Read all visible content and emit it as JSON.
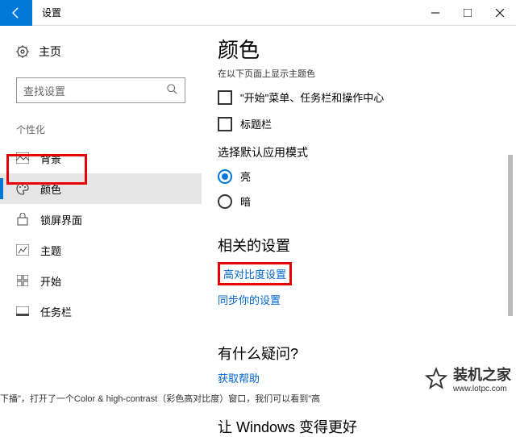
{
  "titlebar": {
    "title": "设置"
  },
  "sidebar": {
    "home": "主页",
    "search_placeholder": "查找设置",
    "section": "个性化",
    "items": [
      {
        "label": "背景",
        "icon": "image-icon"
      },
      {
        "label": "颜色",
        "icon": "palette-icon"
      },
      {
        "label": "锁屏界面",
        "icon": "lock-icon"
      },
      {
        "label": "主题",
        "icon": "theme-icon"
      },
      {
        "label": "开始",
        "icon": "start-icon"
      },
      {
        "label": "任务栏",
        "icon": "taskbar-icon"
      }
    ]
  },
  "main": {
    "title": "颜色",
    "truncated": "在以下页面上显示主题色",
    "checkbox1": "\"开始\"菜单、任务栏和操作中心",
    "checkbox2": "标题栏",
    "mode_heading": "选择默认应用模式",
    "mode_light": "亮",
    "mode_dark": "暗",
    "related_heading": "相关的设置",
    "link_contrast": "高对比度设置",
    "link_sync": "同步你的设置",
    "question_heading": "有什么疑问?",
    "link_help": "获取帮助",
    "improve_heading": "让 Windows 变得更好"
  },
  "bottom_cut": "下播\"，打开了一个Color & high-contrast（彩色高对比度）窗口，我们可以看到\"高",
  "watermark": {
    "text": "装机之家",
    "url": "www.lotpc.com"
  }
}
